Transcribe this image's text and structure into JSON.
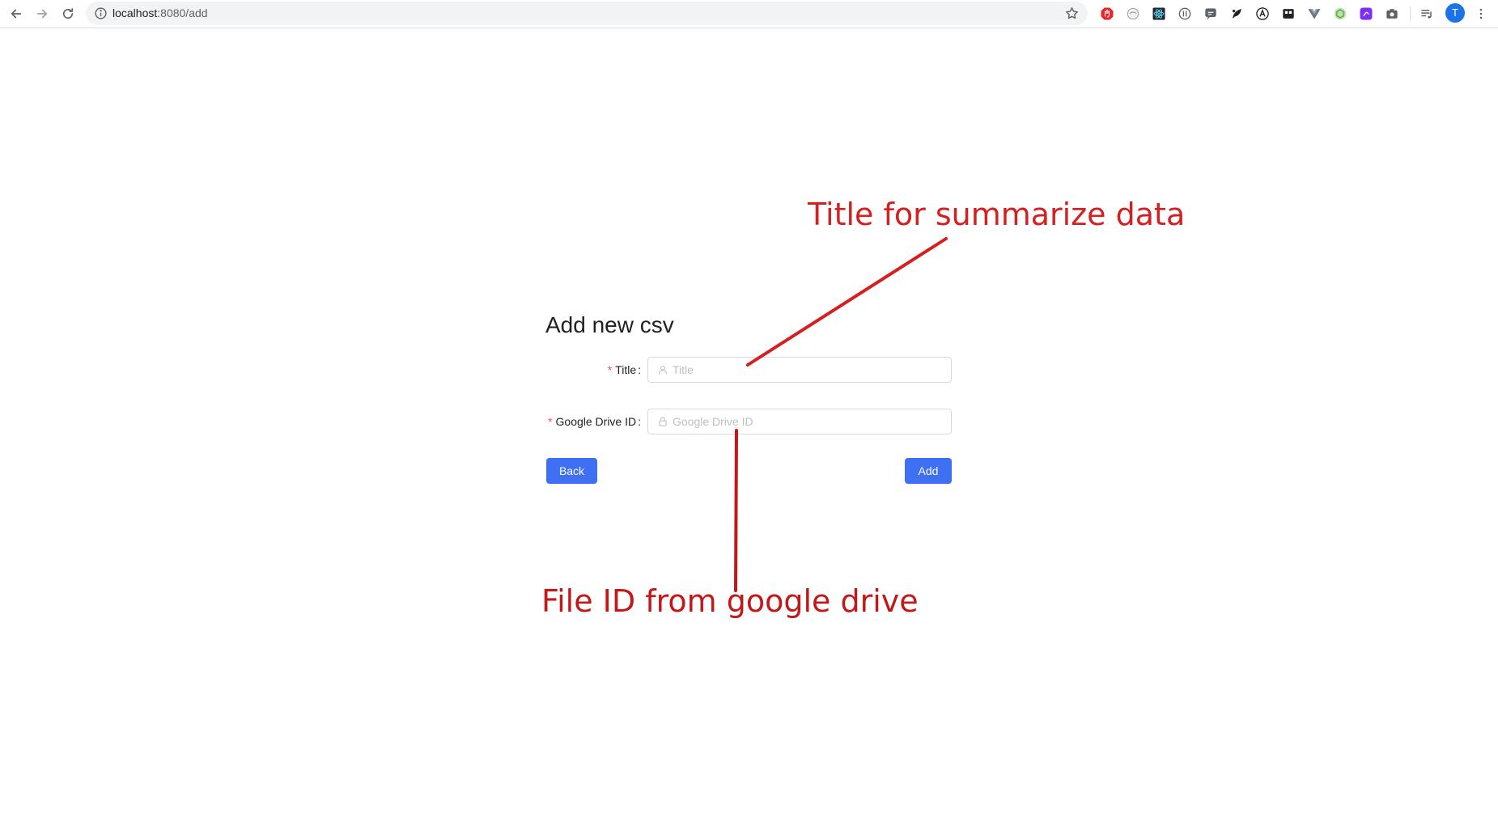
{
  "browser": {
    "url_host": "localhost",
    "url_path": ":8080/add",
    "avatar_initial": "T",
    "extension_icons": [
      "ad-block-icon",
      "privacy-badger-icon",
      "react-devtools-icon",
      "vue-devtools-icon",
      "speech-bubble-icon",
      "feather-icon",
      "translate-icon",
      "clipboard-icon",
      "vuejs-icon",
      "graphql-icon",
      "chat-icon",
      "camera-icon",
      "reading-list-icon"
    ]
  },
  "form": {
    "title": "Add new csv",
    "fields": [
      {
        "label": "Title",
        "placeholder": "Title",
        "value": "",
        "required": true,
        "icon": "user-icon"
      },
      {
        "label": "Google Drive ID",
        "placeholder": "Google Drive ID",
        "value": "",
        "required": true,
        "icon": "lock-icon"
      }
    ],
    "required_mark": "*",
    "colon": ":",
    "back_label": "Back",
    "add_label": "Add"
  },
  "annotations": {
    "title_note": "Title for summarize data",
    "drive_note": "File ID from google drive"
  },
  "colors": {
    "primary_button": "#3f6ff2",
    "annotation_red": "#d42020",
    "required_mark": "#ff4d4f"
  }
}
